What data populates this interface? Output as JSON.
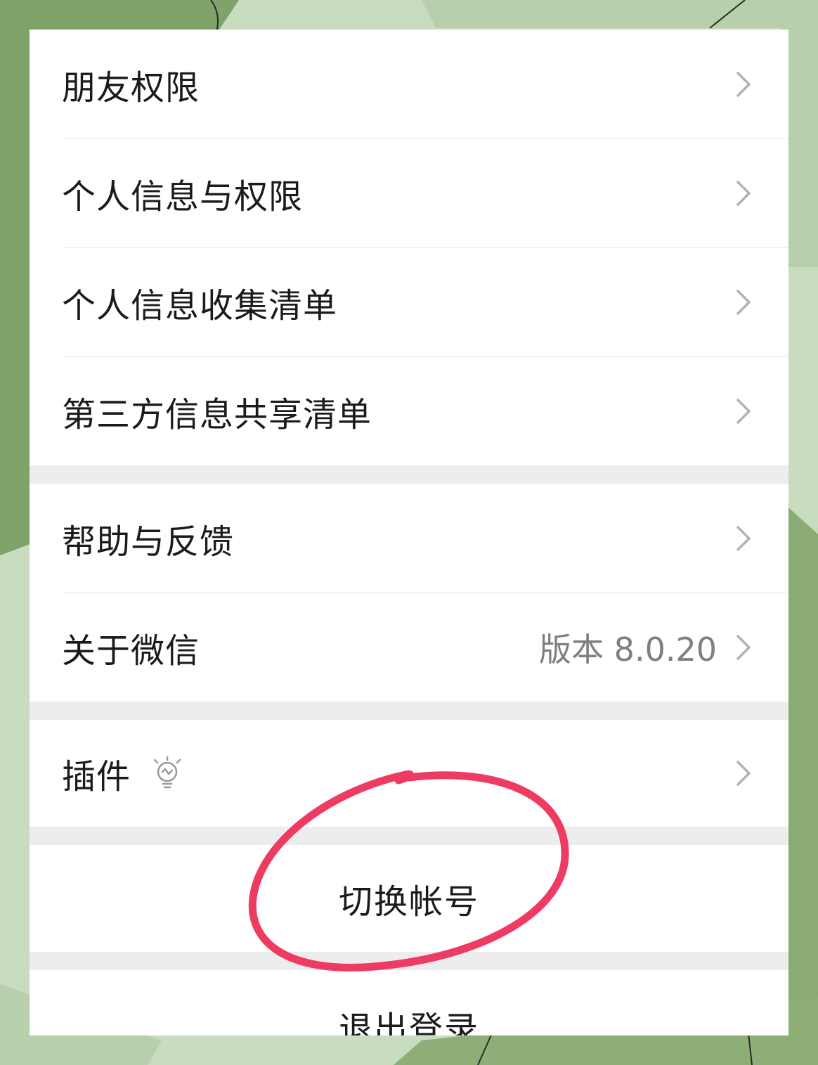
{
  "settings_list": {
    "group1": [
      {
        "label": "朋友权限"
      },
      {
        "label": "个人信息与权限"
      },
      {
        "label": "个人信息收集清单"
      },
      {
        "label": "第三方信息共享清单"
      }
    ],
    "group2": [
      {
        "label": "帮助与反馈"
      },
      {
        "label": "关于微信",
        "value": "版本 8.0.20"
      }
    ],
    "group3": [
      {
        "label": "插件",
        "icon": "lightbulb-icon"
      }
    ]
  },
  "actions": {
    "switch_account": "切换帐号",
    "logout": "退出登录"
  },
  "colors": {
    "annotation": "#ee3b62",
    "background_green": "#7fa36b",
    "background_light": "#c9dcc0"
  }
}
